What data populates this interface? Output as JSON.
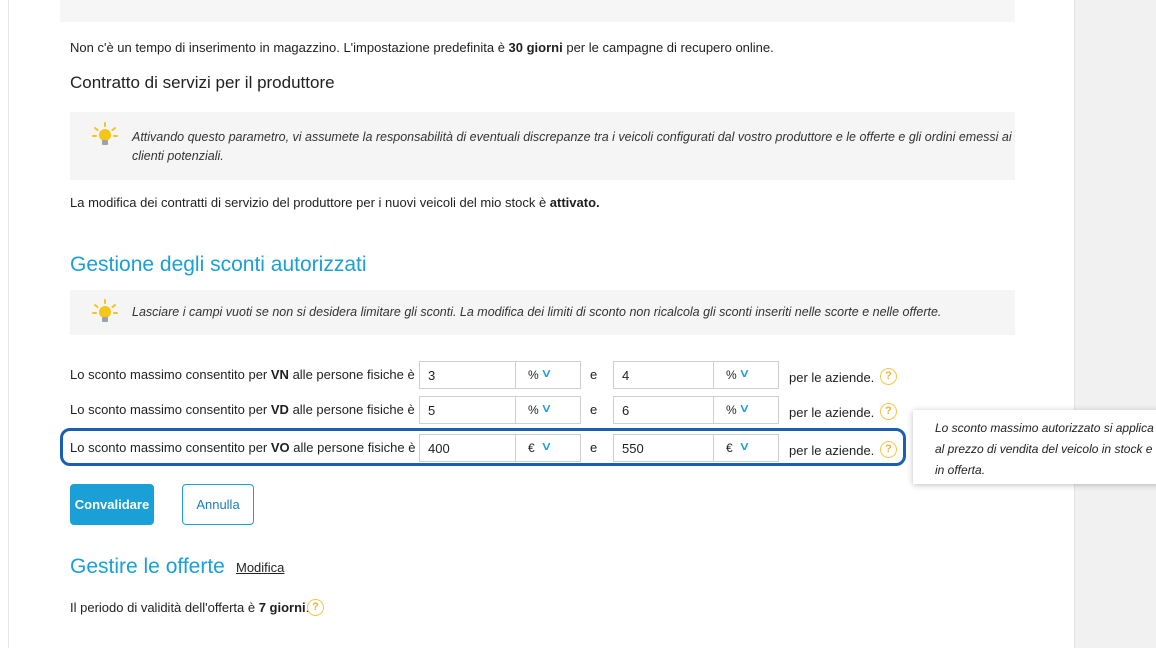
{
  "intro": {
    "prefix": "Non c'è un tempo di inserimento in magazzino. L'impostazione predefinita è ",
    "bold": "30 giorni",
    "suffix": " per le campagne di recupero online."
  },
  "producer_contract": {
    "title": "Contratto di servizi per il produttore",
    "notice_line1": "Attivando questo parametro, vi assumete la responsabilità di eventuali discrepanze tra i veicoli configurati dal vostro produttore e le offerte e gli ordini emessi ai",
    "notice_line2": "clienti potenziali.",
    "status_prefix": "La modifica dei contratti di servizio del produttore per i nuovi veicoli del mio stock è ",
    "status_bold": "attivato."
  },
  "discounts": {
    "title": "Gestione degli sconti autorizzati",
    "notice": "Lasciare i campi vuoti se non si desidera limitare gli sconti. La modifica dei limiti di sconto non ricalcola gli sconti inseriti nelle scorte e nelle offerte.",
    "rows": [
      {
        "label_prefix": "Lo sconto massimo consentito per ",
        "label_bold": "VN",
        "label_suffix": " alle persone fisiche è",
        "individual": "3",
        "individual_unit": "%",
        "conj": "e",
        "company": "4",
        "company_unit": "%",
        "per": "per le aziende."
      },
      {
        "label_prefix": "Lo sconto massimo consentito per ",
        "label_bold": "VD",
        "label_suffix": " alle persone fisiche è",
        "individual": "5",
        "individual_unit": "%",
        "conj": "e",
        "company": "6",
        "company_unit": "%",
        "per": "per le aziende."
      },
      {
        "label_prefix": "Lo sconto massimo consentito per ",
        "label_bold": "VO",
        "label_suffix": " alle persone fisiche è",
        "individual": "400",
        "individual_unit": "€",
        "conj": "e",
        "company": "550",
        "company_unit": "€",
        "per": "per le aziende."
      }
    ],
    "tooltip": "Lo sconto massimo autorizzato si applica al prezzo di vendita del veicolo in stock e in offerta.",
    "validate": "Convalidare",
    "cancel": "Annulla"
  },
  "offers": {
    "title": "Gestire le offerte",
    "edit_link": "Modifica",
    "validity_prefix": "Il periodo di validità dell'offerta è ",
    "validity_bold": "7 giorni",
    "validity_suffix": "."
  },
  "help_glyph": "?",
  "chevron_glyph": "∨",
  "colors": {
    "accent": "#1aa0d6",
    "highlight": "#1a5fb4",
    "bulb": "#f5c518"
  }
}
